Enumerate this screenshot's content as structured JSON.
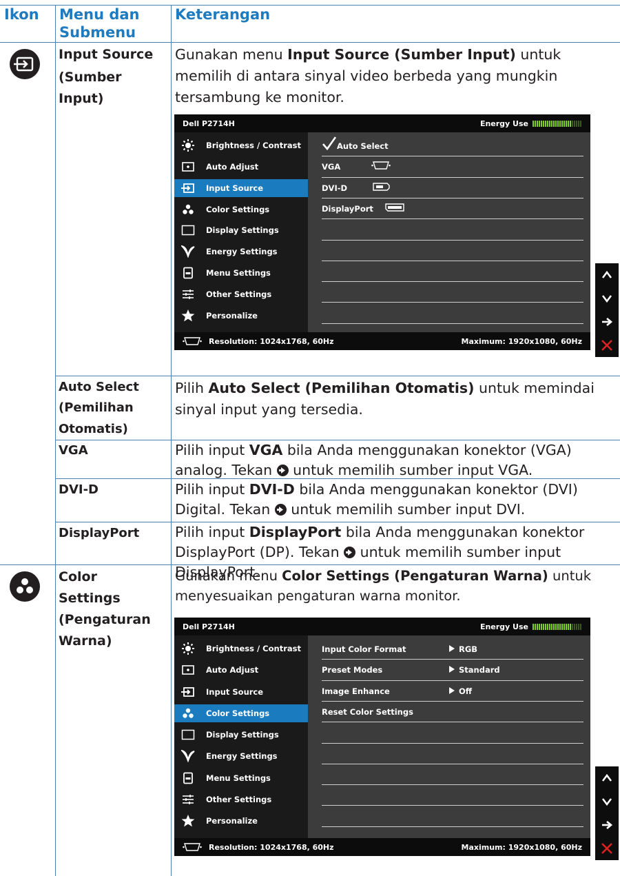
{
  "table_header": {
    "icon": "Ikon",
    "menu": "Menu dan Submenu",
    "menu_line1": "Menu dan",
    "menu_line2": "Submenu",
    "desc": "Keterangan"
  },
  "rows": {
    "input_source": {
      "icon": "input-source-icon",
      "sub_line1": "Input Source",
      "sub_line2": "(Sumber",
      "sub_line3": "Input)",
      "d_pre": "Gunakan menu ",
      "d_bold": "Input Source (Sumber Input)",
      "d_post": " untuk memilih di antara sinyal video berbeda yang mungkin tersambung ke monitor."
    },
    "auto_select": {
      "sub_line1": "Auto Select",
      "sub_line2": "(Pemilihan",
      "sub_line3": "Otomatis)",
      "d_pre": "Pilih ",
      "d_bold": "Auto Select (Pemilihan Otomatis)",
      "d_post": " untuk memindai sinyal input yang tersedia."
    },
    "vga": {
      "sub": "VGA",
      "d_pre": "Pilih input ",
      "d_bold": "VGA",
      "d_post1": " bila Anda menggunakan konektor (VGA) analog. Tekan ",
      "d_post2": " untuk memilih sumber input VGA."
    },
    "dvi": {
      "sub": "DVI-D",
      "d_pre": "Pilih input ",
      "d_bold": "DVI-D",
      "d_post1": " bila Anda menggunakan konektor (DVI) Digital. Tekan ",
      "d_post2": " untuk memilih sumber input DVI."
    },
    "dp": {
      "sub": "DisplayPort",
      "d_pre": "Pilih input ",
      "d_bold": "DisplayPort",
      "d_post1": " bila Anda menggunakan konektor DisplayPort (DP). Tekan ",
      "d_post2": " untuk memilih sumber input DisplayPort."
    },
    "color": {
      "icon": "color-settings-icon",
      "sub_line1": "Color",
      "sub_line2": "Settings",
      "sub_line3": "(Pengaturan",
      "sub_line4": "Warna)",
      "d_pre": "Gunakan menu ",
      "d_bold": "Color Settings (Pengaturan Warna)",
      "d_post": " untuk menyesuaikan pengaturan warna monitor."
    }
  },
  "osd": {
    "model": "Dell P2714H",
    "energy_label": "Energy Use",
    "energy_level": 0.78,
    "resolution": "Resolution: 1024x1768, 60Hz",
    "maximum": "Maximum: 1920x1080, 60Hz",
    "menu": [
      {
        "label": "Brightness / Contrast",
        "icon": "brightness-icon"
      },
      {
        "label": "Auto Adjust",
        "icon": "auto-adjust-icon"
      },
      {
        "label": "Input Source",
        "icon": "input-source-icon"
      },
      {
        "label": "Color Settings",
        "icon": "color-settings-icon"
      },
      {
        "label": "Display Settings",
        "icon": "display-settings-icon"
      },
      {
        "label": "Energy Settings",
        "icon": "energy-icon"
      },
      {
        "label": "Menu Settings",
        "icon": "menu-settings-icon"
      },
      {
        "label": "Other Settings",
        "icon": "other-settings-icon"
      },
      {
        "label": "Personalize",
        "icon": "star-icon"
      }
    ],
    "input_options": [
      {
        "label": "Auto Select",
        "icon": "checkmark-icon"
      },
      {
        "label": "VGA",
        "icon": "vga-connector-icon"
      },
      {
        "label": "DVI-D",
        "icon": "dvi-connector-icon"
      },
      {
        "label": "DisplayPort",
        "icon": "displayport-connector-icon"
      }
    ],
    "color_options": [
      {
        "label": "Input Color Format",
        "value": "RGB"
      },
      {
        "label": "Preset Modes",
        "value": "Standard"
      },
      {
        "label": "Image Enhance",
        "value": "Off"
      },
      {
        "label": "Reset Color Settings",
        "value": ""
      }
    ],
    "nav_buttons": [
      "up-arrow-icon",
      "down-arrow-icon",
      "right-arrow-icon",
      "close-icon"
    ]
  },
  "colors": {
    "header_text": "#1e7bbf",
    "grid": "#4a7fb0",
    "osd_selected": "#1b7bbf",
    "osd_bg": "#3c3c3c",
    "close": "#e02020"
  }
}
